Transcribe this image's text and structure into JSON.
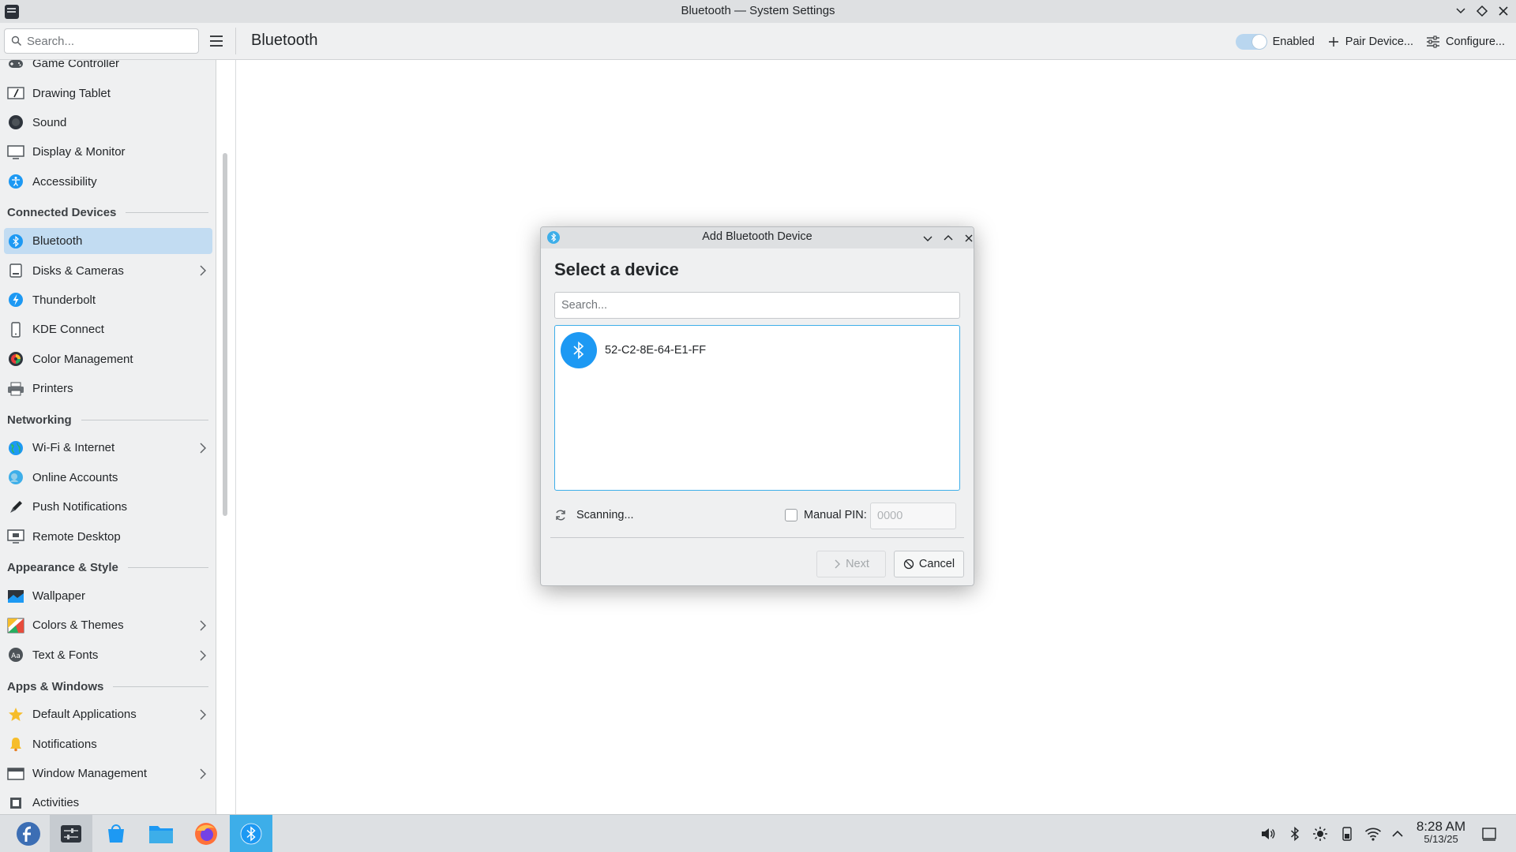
{
  "window": {
    "title": "Bluetooth — System Settings"
  },
  "toolbar": {
    "search_placeholder": "Search...",
    "page_title": "Bluetooth",
    "enabled_label": "Enabled",
    "enabled_state": true,
    "pair_label": "Pair Device...",
    "configure_label": "Configure..."
  },
  "sidebar": {
    "groups": [
      {
        "items": [
          {
            "label": "Game Controller",
            "icon": "gamepad-icon",
            "chevron": false
          },
          {
            "label": "Drawing Tablet",
            "icon": "tablet-icon",
            "chevron": false
          },
          {
            "label": "Sound",
            "icon": "speaker-icon",
            "chevron": false
          },
          {
            "label": "Display & Monitor",
            "icon": "monitor-icon",
            "chevron": false
          },
          {
            "label": "Accessibility",
            "icon": "accessibility-icon",
            "chevron": false
          }
        ]
      },
      {
        "header": "Connected Devices",
        "items": [
          {
            "label": "Bluetooth",
            "icon": "bluetooth-icon",
            "chevron": false,
            "selected": true
          },
          {
            "label": "Disks & Cameras",
            "icon": "disk-icon",
            "chevron": true
          },
          {
            "label": "Thunderbolt",
            "icon": "thunderbolt-icon",
            "chevron": false
          },
          {
            "label": "KDE Connect",
            "icon": "phone-icon",
            "chevron": false
          },
          {
            "label": "Color Management",
            "icon": "color-wheel-icon",
            "chevron": false
          },
          {
            "label": "Printers",
            "icon": "printer-icon",
            "chevron": false
          }
        ]
      },
      {
        "header": "Networking",
        "items": [
          {
            "label": "Wi-Fi & Internet",
            "icon": "globe-icon",
            "chevron": true
          },
          {
            "label": "Online Accounts",
            "icon": "online-accounts-icon",
            "chevron": false
          },
          {
            "label": "Push Notifications",
            "icon": "push-icon",
            "chevron": false
          },
          {
            "label": "Remote Desktop",
            "icon": "remote-desktop-icon",
            "chevron": false
          }
        ]
      },
      {
        "header": "Appearance & Style",
        "items": [
          {
            "label": "Wallpaper",
            "icon": "wallpaper-icon",
            "chevron": false
          },
          {
            "label": "Colors & Themes",
            "icon": "palette-icon",
            "chevron": true
          },
          {
            "label": "Text & Fonts",
            "icon": "font-icon",
            "chevron": true
          }
        ]
      },
      {
        "header": "Apps & Windows",
        "items": [
          {
            "label": "Default Applications",
            "icon": "star-icon",
            "chevron": true
          },
          {
            "label": "Notifications",
            "icon": "bell-icon",
            "chevron": false
          },
          {
            "label": "Window Management",
            "icon": "window-icon",
            "chevron": true
          },
          {
            "label": "Activities",
            "icon": "activities-icon",
            "chevron": false
          }
        ]
      }
    ]
  },
  "dialog": {
    "title": "Add Bluetooth Device",
    "heading": "Select a device",
    "search_placeholder": "Search...",
    "devices": [
      {
        "name": "52-C2-8E-64-E1-FF",
        "icon": "bluetooth-icon"
      }
    ],
    "status": "Scanning...",
    "manual_pin_label": "Manual PIN:",
    "manual_pin_checked": false,
    "pin_placeholder": "0000",
    "next_label": "Next",
    "cancel_label": "Cancel"
  },
  "taskbar": {
    "apps": [
      "fedora-launcher-icon",
      "system-settings-icon",
      "discover-icon",
      "dolphin-icon",
      "firefox-icon",
      "bluetooth-wizard-icon"
    ],
    "time": "8:28 AM",
    "date": "5/13/25"
  },
  "colors": {
    "accent": "#3daee9",
    "selection": "#c2dcf2",
    "window_bg": "#eff0f1",
    "titlebar_bg": "#dee0e2"
  }
}
